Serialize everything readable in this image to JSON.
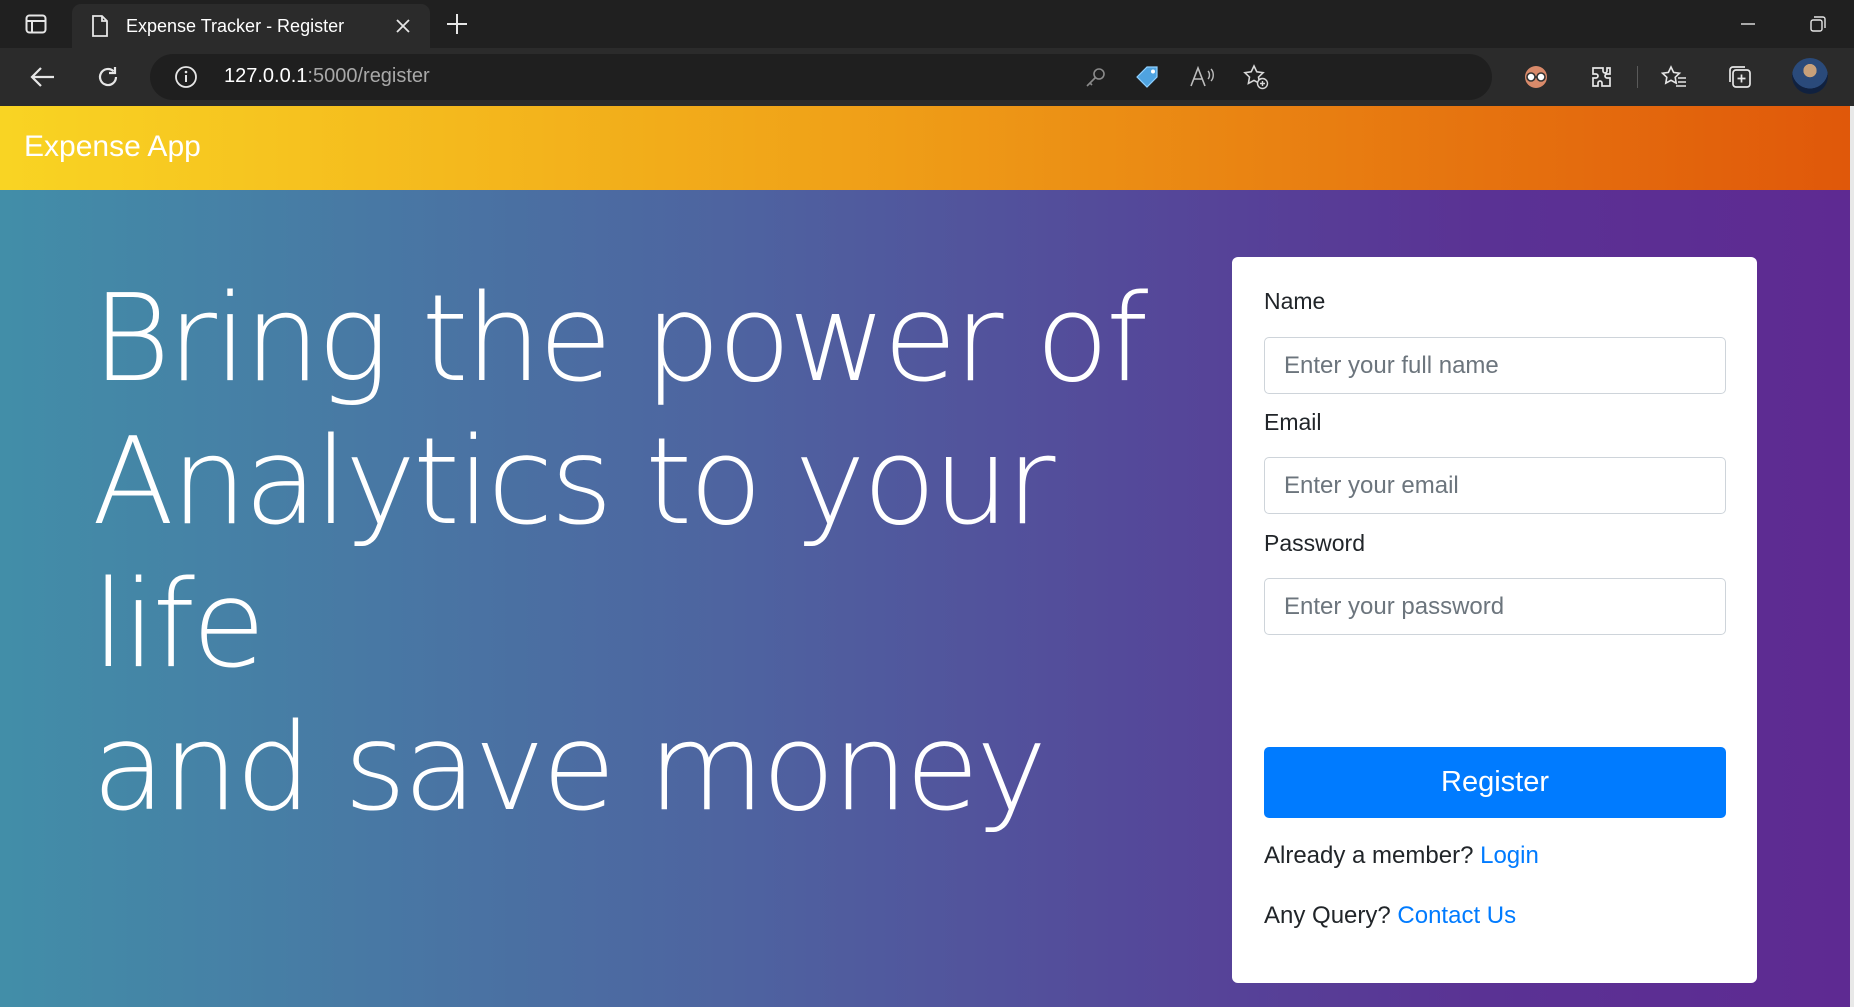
{
  "browser": {
    "tab_title": "Expense Tracker - Register",
    "url_host": "127.0.0.1",
    "url_rest": ":5000/register"
  },
  "navbar": {
    "brand": "Expense App"
  },
  "hero": {
    "line1": "Bring the power of",
    "line2": "Analytics to your life",
    "line3": "and save money"
  },
  "form": {
    "name_label": "Name",
    "name_placeholder": "Enter your full name",
    "email_label": "Email",
    "email_placeholder": "Enter your email",
    "password_label": "Password",
    "password_placeholder": "Enter your password",
    "register_label": "Register",
    "member_text": "Already a member?",
    "login_link": "Login",
    "query_text": "Any Query?",
    "contact_link": "Contact Us"
  },
  "colors": {
    "navbar_start": "#f9d423",
    "navbar_end": "#e0580a",
    "hero_start": "#428ea8",
    "hero_end": "#5e2a92",
    "primary": "#007bff"
  }
}
